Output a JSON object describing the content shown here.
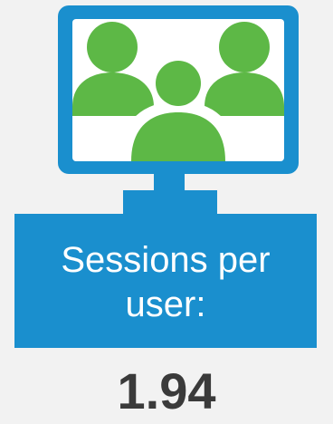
{
  "colors": {
    "background": "#f2f2f2",
    "monitor": "#1a8fce",
    "screen": "#ffffff",
    "people": "#5db846",
    "label_text": "#ffffff",
    "value_text": "#3a3a3a"
  },
  "icon": "monitor-with-users-icon",
  "metric": {
    "label_line1": "Sessions per",
    "label_line2": "user:",
    "value": "1.94"
  }
}
